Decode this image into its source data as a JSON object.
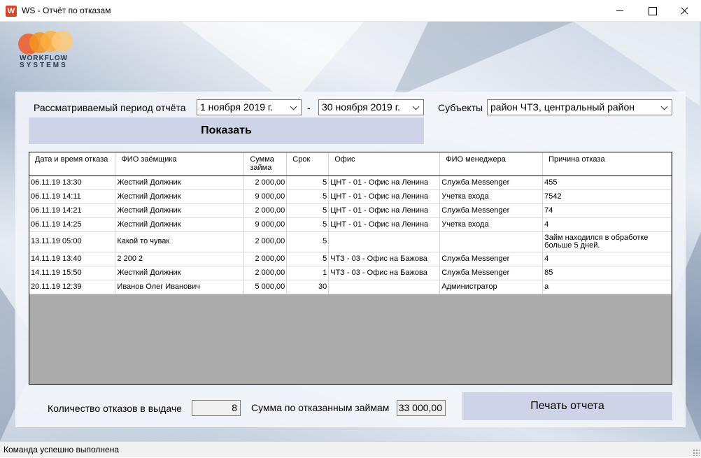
{
  "window": {
    "title": "WS - Отчёт по отказам",
    "icon": "app-logo-icon"
  },
  "logo": {
    "line1": "WORKFLOW",
    "line2": "SYSTEMS"
  },
  "filters": {
    "period_label": "Рассматриваемый период отчёта",
    "date_from": "1   ноября   2019 г.",
    "separator": "-",
    "date_to": "30   ноября   2019 г.",
    "subjects_label": "Субъекты",
    "subjects_value": "район ЧТЗ, центральный район",
    "show_button": "Показать"
  },
  "table": {
    "columns": [
      "Дата и время отказа",
      "ФИО заёмщика",
      "Сумма займа",
      "Срок",
      "Офис",
      "ФИО менеджера",
      "Причина отказа"
    ],
    "rows": [
      [
        "06.11.19 13:30",
        "Жесткий Должник",
        "2 000,00",
        "5",
        "ЦНТ - 01 - Офис на Ленина",
        "Служба Messenger",
        "455"
      ],
      [
        "06.11.19 14:11",
        "Жесткий Должник",
        "9 000,00",
        "5",
        "ЦНТ - 01 - Офис на Ленина",
        "Учетка входа",
        "7542"
      ],
      [
        "06.11.19 14:21",
        "Жесткий Должник",
        "2 000,00",
        "5",
        "ЦНТ - 01 - Офис на Ленина",
        "Служба Messenger",
        "74"
      ],
      [
        "06.11.19 14:25",
        "Жесткий Должник",
        "9 000,00",
        "5",
        "ЦНТ - 01 - Офис на Ленина",
        "Учетка входа",
        "4"
      ],
      [
        "13.11.19 05:00",
        "Какой то чувак",
        "2 000,00",
        "5",
        "",
        "",
        "Займ находился в обработке больше 5 дней."
      ],
      [
        "14.11.19 13:40",
        "2 200 2",
        "2 000,00",
        "5",
        "ЧТЗ - 03 - Офис на Бажова",
        "Служба Messenger",
        "4"
      ],
      [
        "14.11.19 15:50",
        "Жесткий Должник",
        "2 000,00",
        "1",
        "ЧТЗ - 03 - Офис на Бажова",
        "Служба Messenger",
        "85"
      ],
      [
        "20.11.19 12:39",
        "Иванов Олег Иванович",
        "5 000,00",
        "30",
        "",
        "Администратор",
        "а"
      ]
    ]
  },
  "footer": {
    "count_label": "Количество отказов в выдаче",
    "count_value": "8",
    "sum_label": "Сумма по отказанным займам",
    "sum_value": "33 000,00",
    "print_button": "Печать отчета"
  },
  "status": {
    "text": "Команда успешно выполнена"
  }
}
